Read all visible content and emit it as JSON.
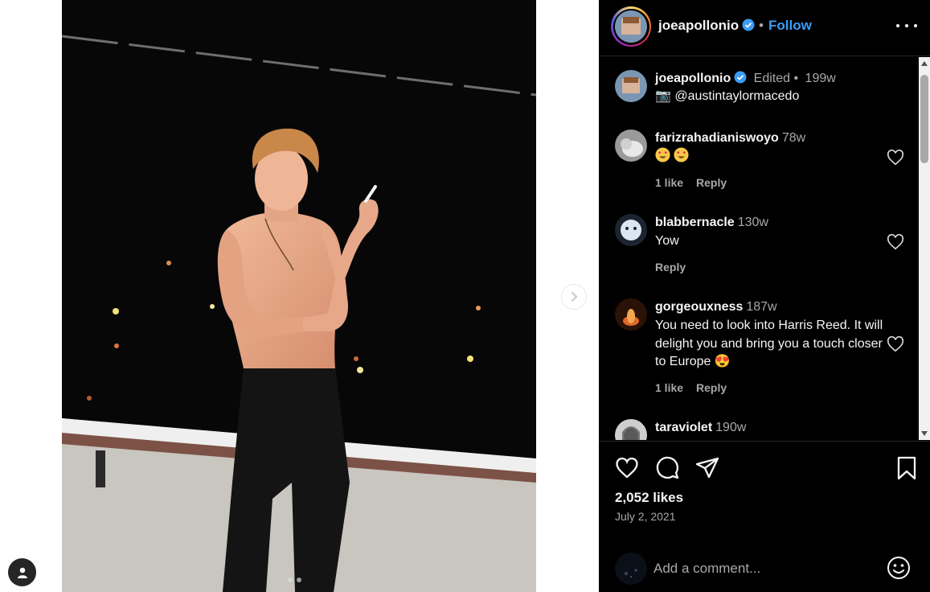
{
  "header": {
    "username": "joeapollonio",
    "separator": "•",
    "follow_label": "Follow"
  },
  "caption": {
    "username": "joeapollonio",
    "edited": "Edited •",
    "time": "199w",
    "text": "📷 @austintaylormacedo"
  },
  "comments": [
    {
      "username": "farizrahadianiswoyo",
      "time": "78w",
      "text": "😍😍",
      "likes": "1 like",
      "reply": "Reply"
    },
    {
      "username": "blabbernacle",
      "time": "130w",
      "text": "Yow",
      "likes": "",
      "reply": "Reply"
    },
    {
      "username": "gorgeouxness",
      "time": "187w",
      "text": "You need to look into Harris Reed. It will delight you and bring you a touch closer to Europe 😍",
      "likes": "1 like",
      "reply": "Reply"
    },
    {
      "username": "taraviolet",
      "time": "190w",
      "text": "",
      "likes": "",
      "reply": ""
    }
  ],
  "post": {
    "likes": "2,052 likes",
    "date": "July 2, 2021"
  },
  "composer": {
    "placeholder": "Add a comment..."
  },
  "icons": [
    "verified-badge-icon",
    "more-options-icon",
    "heart-icon",
    "comment-icon",
    "share-icon",
    "bookmark-icon",
    "emoji-icon",
    "chevron-right-icon",
    "user-icon"
  ],
  "colors": {
    "link": "#3b9cf7",
    "panel_bg": "#000000",
    "muted": "#a8a8a8"
  }
}
